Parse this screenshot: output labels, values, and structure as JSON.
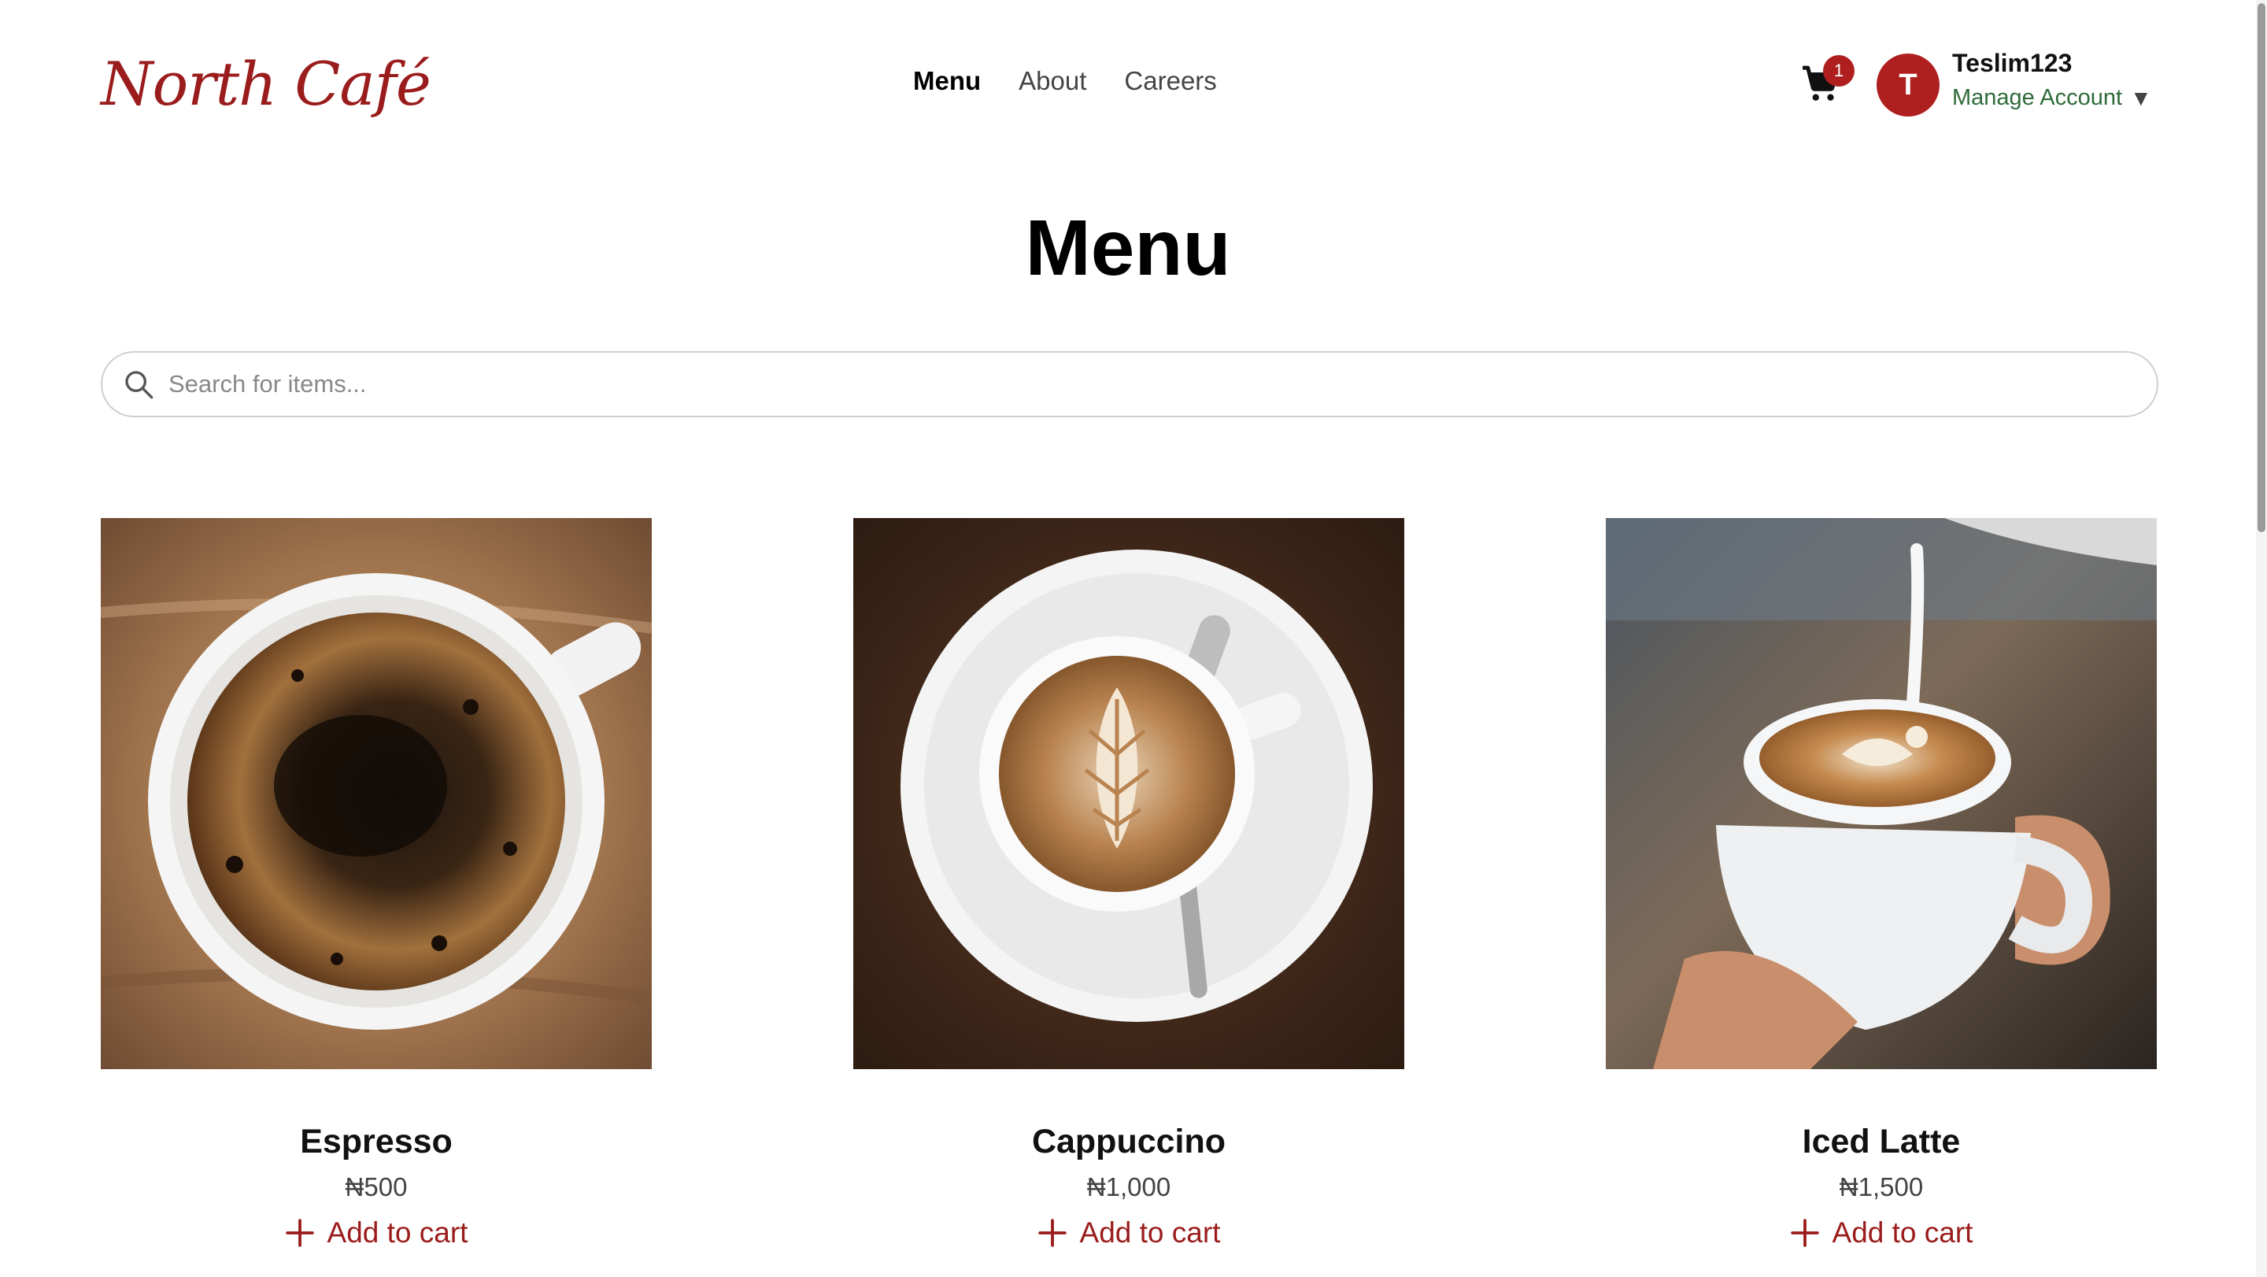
{
  "brand": {
    "name": "North Café",
    "color": "#9b1c1c"
  },
  "nav": {
    "items": [
      "Menu",
      "About",
      "Careers"
    ],
    "active": "Menu"
  },
  "cart": {
    "count": "1",
    "icon": "cart-icon"
  },
  "user": {
    "initial": "T",
    "username": "Teslim123",
    "manage_label": "Manage Account",
    "caret": "▼"
  },
  "page": {
    "title": "Menu"
  },
  "search": {
    "placeholder": "Search for items...",
    "value": "",
    "icon": "search-icon"
  },
  "products": [
    {
      "name": "Espresso",
      "price": "₦500",
      "add_label": "Add to cart"
    },
    {
      "name": "Cappuccino",
      "price": "₦1,000",
      "add_label": "Add to cart"
    },
    {
      "name": "Iced Latte",
      "price": "₦1,500",
      "add_label": "Add to cart"
    }
  ],
  "colors": {
    "accent": "#b01f1f",
    "account_link": "#2f6b3a"
  }
}
